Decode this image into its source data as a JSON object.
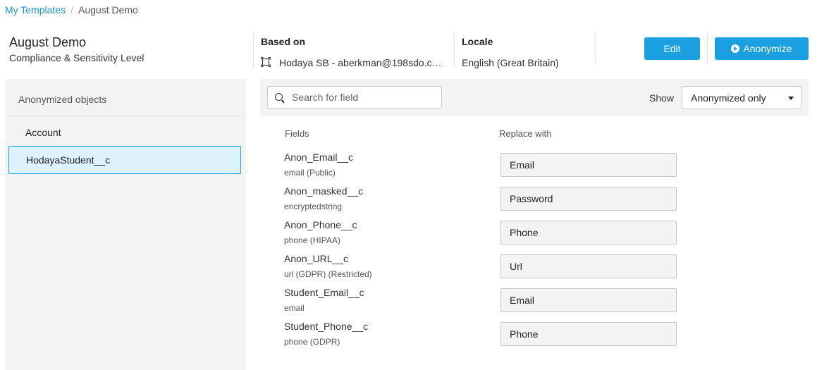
{
  "breadcrumb": {
    "parent": "My Templates",
    "separator": "/",
    "current": "August Demo"
  },
  "header": {
    "title": "August Demo",
    "subtitle": "Compliance & Sensitivity Level",
    "based_on_label": "Based on",
    "based_on_value": "Hodaya SB - aberkman@198sdo.c…",
    "locale_label": "Locale",
    "locale_value": "English (Great Britain)",
    "edit_label": "Edit",
    "anonymize_label": "Anonymize"
  },
  "objects": {
    "title": "Anonymized objects",
    "items": [
      {
        "label": "Account"
      },
      {
        "label": "HodayaStudent__c"
      }
    ]
  },
  "toolbar": {
    "search_placeholder": "Search for field",
    "show_label": "Show",
    "show_value": "Anonymized only"
  },
  "table": {
    "col_fields": "Fields",
    "col_replace": "Replace with",
    "rows": [
      {
        "name": "Anon_Email__c",
        "type": "email (Public)",
        "replace": "Email"
      },
      {
        "name": "Anon_masked__c",
        "type": "encryptedstring",
        "replace": "Password"
      },
      {
        "name": "Anon_Phone__c",
        "type": "phone (HIPAA)",
        "replace": "Phone"
      },
      {
        "name": "Anon_URL__c",
        "type": "url (GDPR) (Restricted)",
        "replace": "Url"
      },
      {
        "name": "Student_Email__c",
        "type": "email",
        "replace": "Email"
      },
      {
        "name": "Student_Phone__c",
        "type": "phone (GDPR)",
        "replace": "Phone"
      }
    ]
  },
  "colors": {
    "accent": "#1a9fe0",
    "link": "#1a8fd6",
    "selected_bg": "#ddf2fc",
    "panel_bg": "#f3f3f3"
  },
  "icons": {
    "org": "org-icon",
    "play": "play-circle-icon",
    "search": "search-icon",
    "dropdown": "chevron-down-icon"
  }
}
